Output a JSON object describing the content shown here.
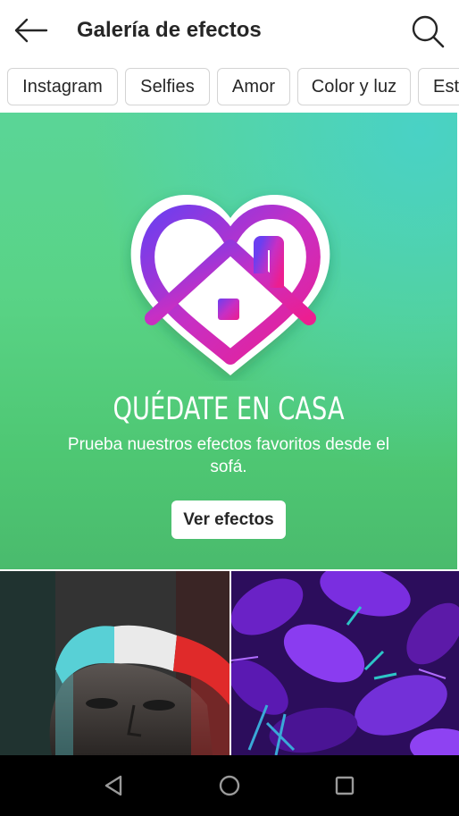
{
  "header": {
    "title": "Galería de efectos",
    "back_icon": "arrow-left-icon",
    "search_icon": "search-icon"
  },
  "categories": [
    {
      "label": "Instagram"
    },
    {
      "label": "Selfies"
    },
    {
      "label": "Amor"
    },
    {
      "label": "Color y luz"
    },
    {
      "label": "Est"
    }
  ],
  "banner": {
    "logo_icon": "heart-house-icon",
    "title": "QUÉDATE EN CASA",
    "subtitle": "Prueba nuestros efectos favoritos desde el sofá.",
    "button_label": "Ver efectos",
    "background_colors": [
      "#5ad597",
      "#4abb6d",
      "#48d2c8"
    ],
    "logo_gradient": [
      "#7b3fe4",
      "#d02bb0",
      "#e91e8c"
    ]
  },
  "thumbnails": [
    {
      "name": "effect-thumbnail-tricolor-face"
    },
    {
      "name": "effect-thumbnail-purple-leaves"
    }
  ],
  "system_nav": {
    "back_icon": "triangle-back-icon",
    "home_icon": "circle-home-icon",
    "recents_icon": "square-recents-icon"
  }
}
